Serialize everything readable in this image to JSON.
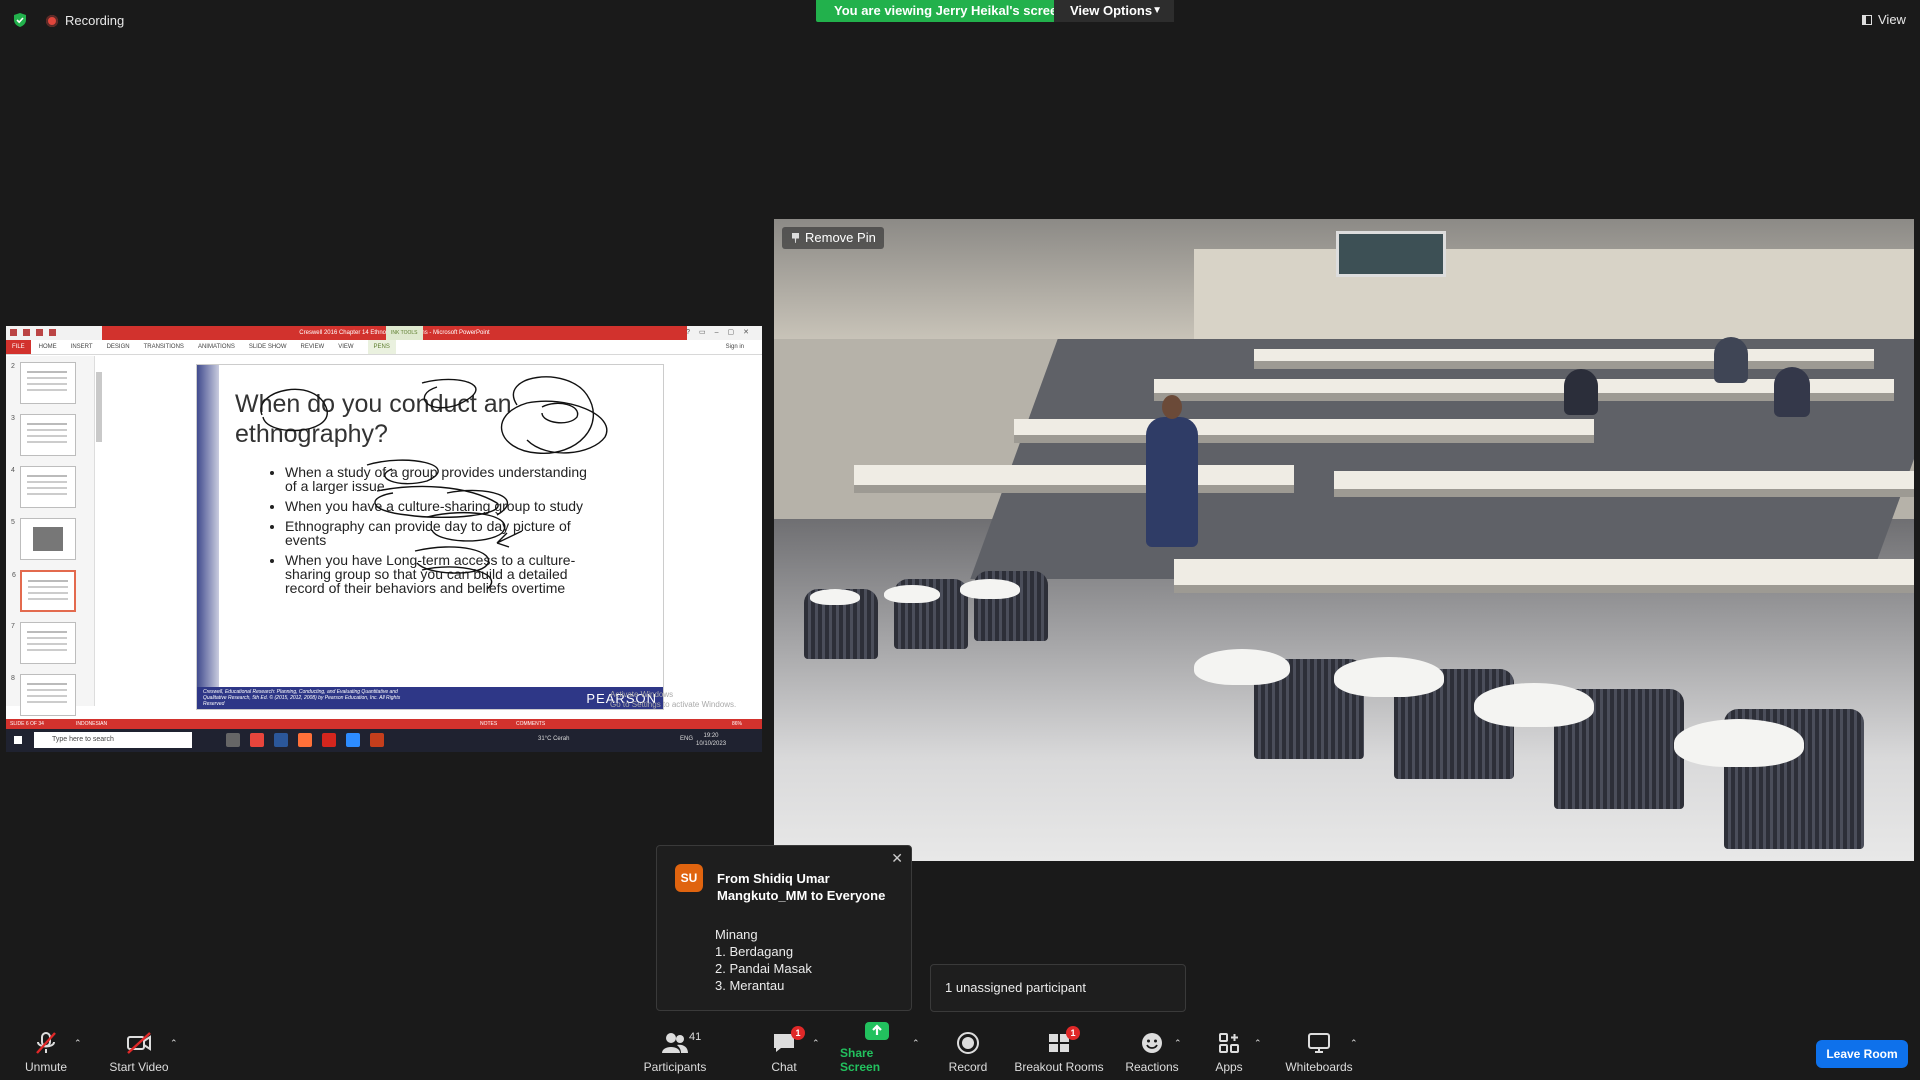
{
  "topbar": {
    "recording_label": "Recording",
    "viewing_banner": "You are viewing Jerry Heikal's screen",
    "view_options_label": "View Options",
    "view_label": "View"
  },
  "shared_screen": {
    "window_title": "Creswell 2016 Chapter 14 Ethnography Designs - Microsoft PowerPoint",
    "ink_tools_label": "INK TOOLS",
    "ribbon_tabs": [
      "FILE",
      "HOME",
      "INSERT",
      "DESIGN",
      "TRANSITIONS",
      "ANIMATIONS",
      "SLIDE SHOW",
      "REVIEW",
      "VIEW",
      "PENS"
    ],
    "sign_in": "Sign in",
    "thumbnail_numbers": [
      "2",
      "3",
      "4",
      "5",
      "6",
      "7",
      "8"
    ],
    "selected_thumbnail": "6",
    "slide": {
      "title": "When do you conduct an ethnography?",
      "bullets": [
        "When a study of a group provides understanding of a larger issue",
        "When you have a culture-sharing group to study",
        "Ethnography can provide day to day picture of events",
        "When you have Long-term access to a culture-sharing group so that you can build a detailed record of their behaviors and beliefs overtime"
      ],
      "footer_citation": "Creswell, Educational Research: Planning, Conducting, and Evaluating Quantitative and Qualitative Research, 5th Ed. © (2015, 2012, 2008) by Pearson Education, Inc. All Rights Reserved",
      "footer_brand": "PEARSON"
    },
    "activate_windows": [
      "Activate Windows",
      "Go to Settings to activate Windows."
    ],
    "status": {
      "slide_counter": "SLIDE 6 OF 34",
      "language": "INDONESIAN",
      "notes": "NOTES",
      "comments": "COMMENTS",
      "zoom": "86%"
    },
    "taskbar": {
      "search_placeholder": "Type here to search",
      "weather": "31°C  Cerah",
      "lang": "ENG",
      "time": "19:20",
      "date": "10/10/2023"
    }
  },
  "video": {
    "remove_pin_label": "Remove Pin"
  },
  "chat_popup": {
    "avatar_initials": "SU",
    "from": "From Shidiq Umar Mangkuto_MM to Everyone",
    "message": "Minang\n1. Berdagang\n2. Pandai Masak\n3. Merantau",
    "avatar_color": "#e0640f"
  },
  "unassigned_notice": "1 unassigned participant",
  "toolbar": {
    "unmute": "Unmute",
    "start_video": "Start Video",
    "participants": "Participants",
    "participants_count": "41",
    "chat": "Chat",
    "chat_badge": "1",
    "share_screen": "Share Screen",
    "record": "Record",
    "breakout_rooms": "Breakout Rooms",
    "breakout_badge": "1",
    "reactions": "Reactions",
    "apps": "Apps",
    "whiteboards": "Whiteboards",
    "leave_room": "Leave Room"
  },
  "colors": {
    "accent_green": "#22b14c",
    "leave_blue": "#0e71eb",
    "badge_red": "#e02828"
  }
}
